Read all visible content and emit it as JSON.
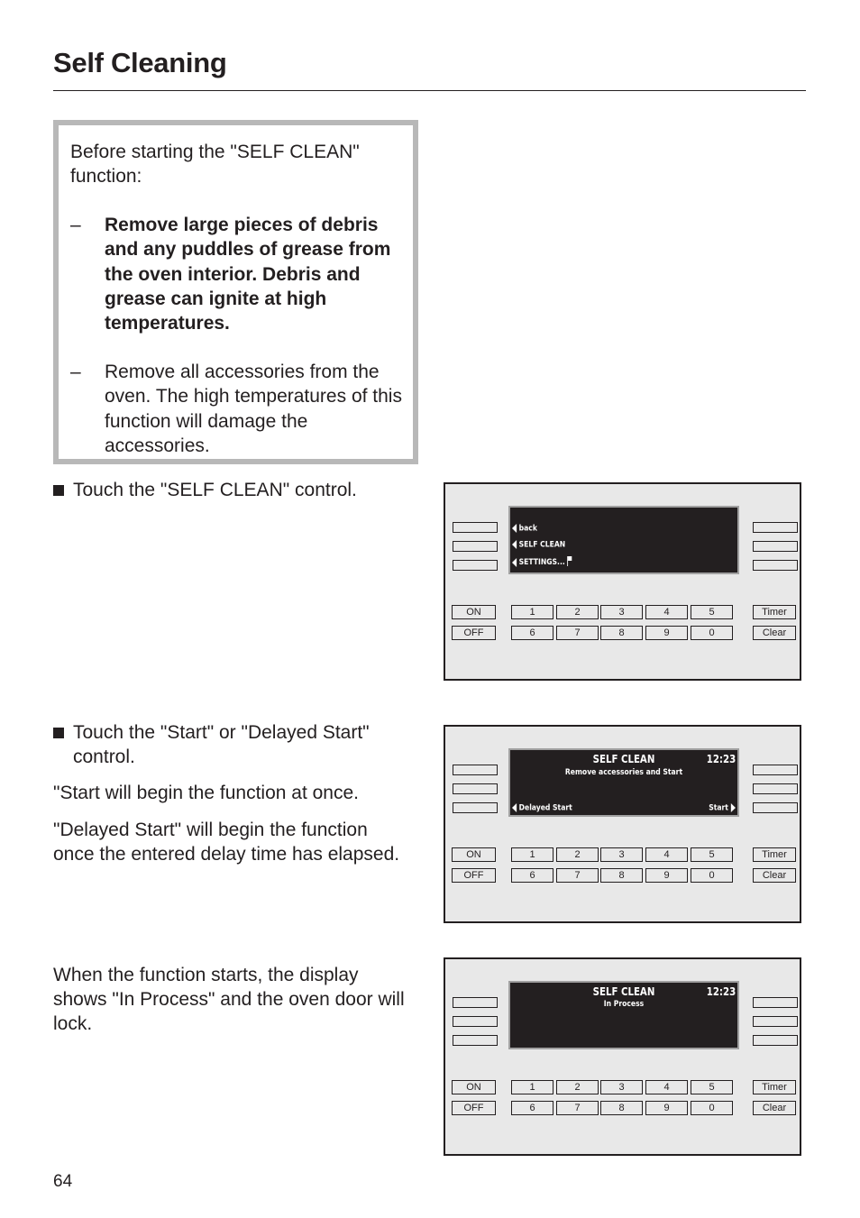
{
  "page": {
    "title": "Self Cleaning",
    "page_number": "64"
  },
  "warning": {
    "intro": "Before starting the \"SELF CLEAN\" function:",
    "items": [
      {
        "dash": "–",
        "text": "Remove large pieces of debris and any puddles of grease from the oven interior. Debris and grease can ignite at high temperatures.",
        "bold": true
      },
      {
        "dash": "–",
        "text": "Remove all accessories from the oven. The high temperatures of this function will damage the accessories.",
        "bold": false
      }
    ]
  },
  "steps": {
    "step1": "Touch the \"SELF CLEAN\" control.",
    "step2": "Touch the \"Start\" or \"Delayed Start\" control.",
    "step2_note1": "\"Start will begin the function at once.",
    "step2_note2": "\"Delayed Start\" will begin the function once the entered delay time has elapsed.",
    "step3": "When the function starts, the display shows \"In Process\" and the oven door will lock."
  },
  "keypad": {
    "on": "ON",
    "off": "OFF",
    "row1": [
      "1",
      "2",
      "3",
      "4",
      "5"
    ],
    "row2": [
      "6",
      "7",
      "8",
      "9",
      "0"
    ],
    "timer": "Timer",
    "clear": "Clear"
  },
  "panels": [
    {
      "menu": [
        "back",
        "SELF CLEAN",
        "SETTINGS..."
      ]
    },
    {
      "title": "SELF CLEAN",
      "time": "12:23",
      "subtitle": "Remove accessories and Start",
      "left_action": "Delayed Start",
      "right_action": "Start"
    },
    {
      "title": "SELF CLEAN",
      "time": "12:23",
      "subtitle": "In Process"
    }
  ]
}
